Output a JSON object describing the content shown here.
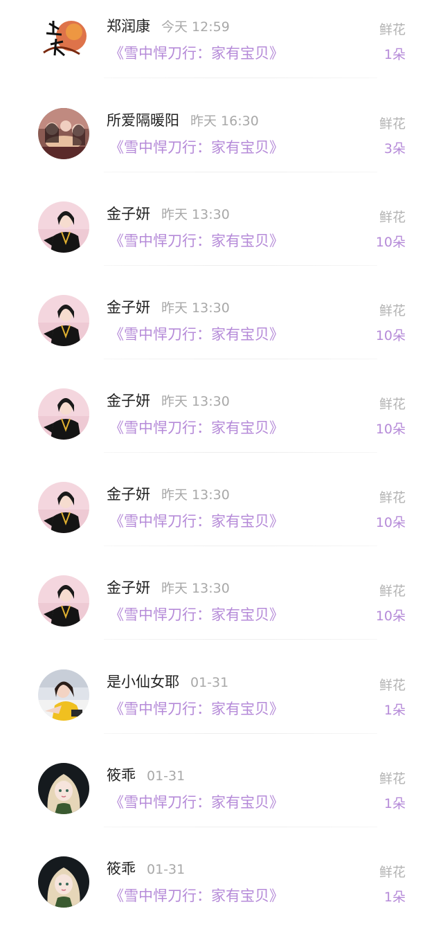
{
  "list": {
    "items": [
      {
        "name": "郑润康",
        "time": "今天 12:59",
        "book": "《雪中悍刀行：家有宝贝》",
        "gift_label": "鲜花",
        "gift_count": "1朵",
        "avatar": "avatar-calligraphy"
      },
      {
        "name": "所爱隔暖阳",
        "time": "昨天 16:30",
        "book": "《雪中悍刀行：家有宝贝》",
        "gift_label": "鲜花",
        "gift_count": "3朵",
        "avatar": "avatar-group-dining"
      },
      {
        "name": "金子妍",
        "time": "昨天 13:30",
        "book": "《雪中悍刀行：家有宝贝》",
        "gift_label": "鲜花",
        "gift_count": "10朵",
        "avatar": "avatar-girl-pink"
      },
      {
        "name": "金子妍",
        "time": "昨天 13:30",
        "book": "《雪中悍刀行：家有宝贝》",
        "gift_label": "鲜花",
        "gift_count": "10朵",
        "avatar": "avatar-girl-pink"
      },
      {
        "name": "金子妍",
        "time": "昨天 13:30",
        "book": "《雪中悍刀行：家有宝贝》",
        "gift_label": "鲜花",
        "gift_count": "10朵",
        "avatar": "avatar-girl-pink"
      },
      {
        "name": "金子妍",
        "time": "昨天 13:30",
        "book": "《雪中悍刀行：家有宝贝》",
        "gift_label": "鲜花",
        "gift_count": "10朵",
        "avatar": "avatar-girl-pink"
      },
      {
        "name": "金子妍",
        "time": "昨天 13:30",
        "book": "《雪中悍刀行：家有宝贝》",
        "gift_label": "鲜花",
        "gift_count": "10朵",
        "avatar": "avatar-girl-pink"
      },
      {
        "name": "是小仙女耶",
        "time": "01-31",
        "book": "《雪中悍刀行：家有宝贝》",
        "gift_label": "鲜花",
        "gift_count": "1朵",
        "avatar": "avatar-girl-yellow"
      },
      {
        "name": "筱乖",
        "time": "01-31",
        "book": "《雪中悍刀行：家有宝贝》",
        "gift_label": "鲜花",
        "gift_count": "1朵",
        "avatar": "avatar-anime-blonde"
      },
      {
        "name": "筱乖",
        "time": "01-31",
        "book": "《雪中悍刀行：家有宝贝》",
        "gift_label": "鲜花",
        "gift_count": "1朵",
        "avatar": "avatar-anime-blonde"
      }
    ]
  },
  "colors": {
    "name": "#222222",
    "time": "#a8a8a8",
    "book": "#b58ad8",
    "gift_label": "#b3b3b3",
    "gift_count": "#b58ad8"
  }
}
